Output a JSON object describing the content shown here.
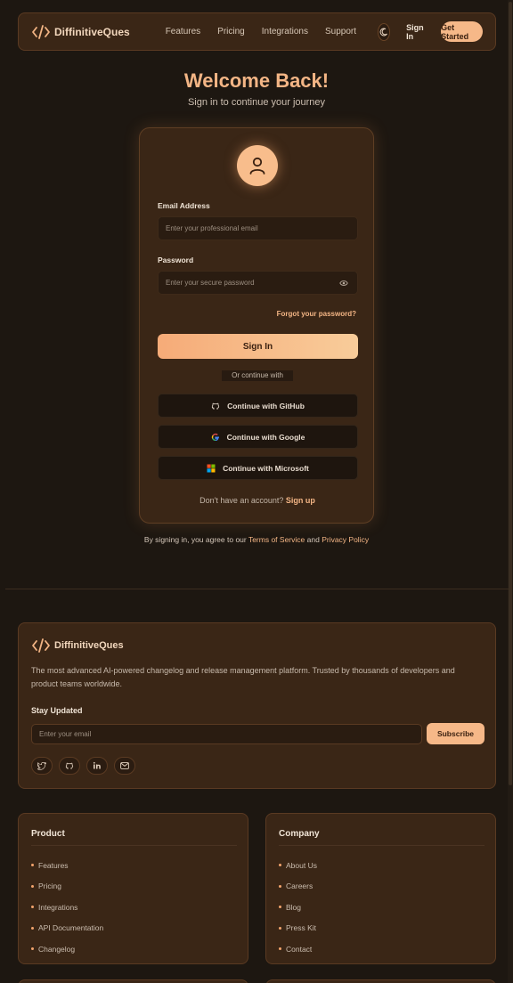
{
  "brand": {
    "name": "DiffinitiveQues"
  },
  "nav": {
    "links": [
      "Features",
      "Pricing",
      "Integrations",
      "Support"
    ],
    "sign_in": "Sign In",
    "get_started": "Get Started"
  },
  "hero": {
    "title": "Welcome Back!",
    "subtitle": "Sign in to continue your journey"
  },
  "form": {
    "email_label": "Email Address",
    "email_placeholder": "Enter your professional email",
    "password_label": "Password",
    "password_placeholder": "Enter your secure password",
    "forgot": "Forgot your password?",
    "submit": "Sign In",
    "divider": "Or continue with",
    "github": "Continue with GitHub",
    "google": "Continue with Google",
    "microsoft": "Continue with Microsoft",
    "no_account": "Don't have an account?",
    "sign_up": "Sign up"
  },
  "terms": {
    "prefix": "By signing in, you agree to our",
    "tos": "Terms of Service",
    "and": "and",
    "privacy": "Privacy Policy"
  },
  "footer": {
    "description": "The most advanced AI-powered changelog and release management platform. Trusted by thousands of developers and product teams worldwide.",
    "stay_updated": "Stay Updated",
    "email_placeholder": "Enter your email",
    "subscribe": "Subscribe",
    "socials": [
      "twitter-icon",
      "github-icon",
      "linkedin-icon",
      "mail-icon"
    ],
    "product": {
      "title": "Product",
      "items": [
        "Features",
        "Pricing",
        "Integrations",
        "API Documentation",
        "Changelog"
      ]
    },
    "company": {
      "title": "Company",
      "items": [
        "About Us",
        "Careers",
        "Blog",
        "Press Kit",
        "Contact"
      ]
    }
  },
  "colors": {
    "accent": "#f3b585",
    "background": "#1d1711",
    "card": "#3a2616"
  }
}
